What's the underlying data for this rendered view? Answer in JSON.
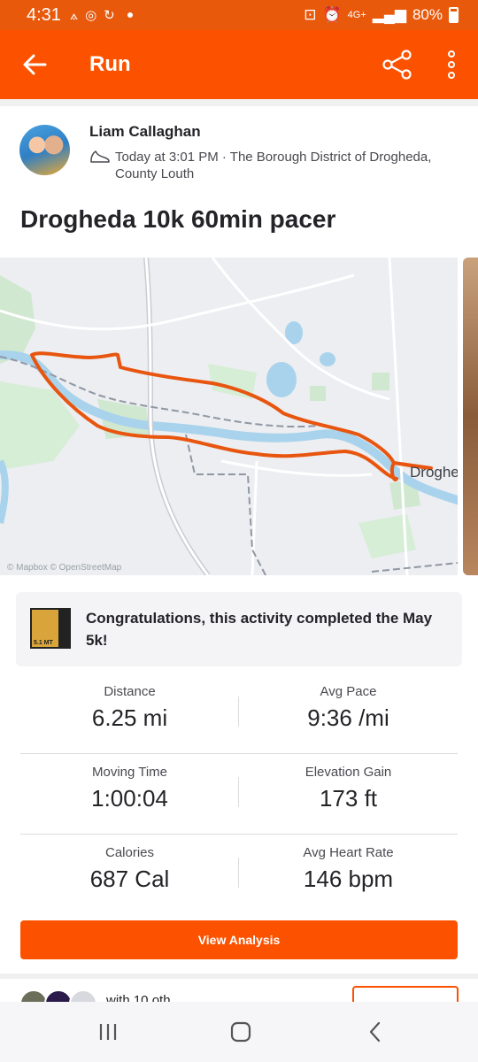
{
  "status_bar": {
    "time": "4:31",
    "network": "4G+",
    "battery": "80%"
  },
  "app_bar": {
    "title": "Run"
  },
  "athlete": {
    "name": "Liam Callaghan",
    "meta": "Today at 3:01 PM · The Borough District of Drogheda, County Louth"
  },
  "activity": {
    "title": "Drogheda 10k 60min pacer"
  },
  "map": {
    "town_label": "Drogheda",
    "attribution": "© Mapbox © OpenStreetMap",
    "route_color": "#e8550f"
  },
  "achievement": {
    "text": "Congratulations, this activity completed the May 5k!",
    "badge_text": "5.1 MT"
  },
  "stats": [
    {
      "left": {
        "label": "Distance",
        "value": "6.25 mi"
      },
      "right": {
        "label": "Avg Pace",
        "value": "9:36 /mi"
      }
    },
    {
      "left": {
        "label": "Moving Time",
        "value": "1:00:04"
      },
      "right": {
        "label": "Elevation Gain",
        "value": "173 ft"
      }
    },
    {
      "left": {
        "label": "Calories",
        "value": "687 Cal"
      },
      "right": {
        "label": "Avg Heart Rate",
        "value": "146 bpm"
      }
    }
  ],
  "buttons": {
    "view_analysis": "View Analysis"
  },
  "kudos_row": {
    "text": "with 10 oth"
  },
  "colors": {
    "brand": "#fc5200",
    "status_bar": "#e8590c"
  }
}
